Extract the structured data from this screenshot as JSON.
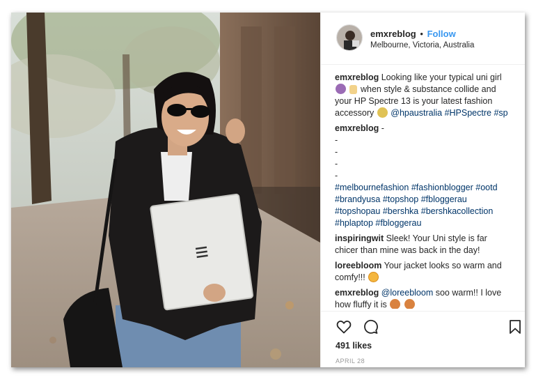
{
  "post": {
    "username": "emxreblog",
    "separator": "•",
    "follow_label": "Follow",
    "location": "Melbourne, Victoria, Australia",
    "likes": "491 likes",
    "date": "APRIL 28"
  },
  "caption": {
    "user": "emxreblog",
    "line1": "Looking like your typical uni girl",
    "line2": "when style & substance collide and",
    "line3": "your HP Spectre 13 is your latest fashion",
    "line4": "accessory",
    "mention": "@hpaustralia",
    "tag1": "#HPSpectre",
    "tag2": "#sp"
  },
  "hashtag_comment": {
    "user": "emxreblog",
    "dash": "-",
    "dots": [
      "-",
      "-",
      "-",
      "-"
    ],
    "tags": [
      "#melbournefashion",
      "#fashionblogger",
      "#ootd",
      "#brandyusa",
      "#topshop",
      "#fbloggerau",
      "#topshopau",
      "#bershka",
      "#bershkacollection",
      "#hplaptop",
      "#fbloggerau"
    ]
  },
  "comments": [
    {
      "user": "inspiringwit",
      "line1": "Sleek! Your Uni style is far",
      "line2": "chicer than mine was back in the day!"
    },
    {
      "user": "loreebloom",
      "line1": "Your jacket looks so warm and",
      "line2": "comfy!!!"
    },
    {
      "user": "emxreblog",
      "mention": "@loreebloom",
      "line1": "soo warm!! I love",
      "line2": "how fluffy it is"
    }
  ],
  "icons": {
    "like": "heart-icon",
    "comment": "comment-bubble-icon",
    "save": "bookmark-icon"
  },
  "colors": {
    "link": "#3897f0",
    "hashtag": "#003569",
    "text": "#262626",
    "muted": "#999999"
  }
}
